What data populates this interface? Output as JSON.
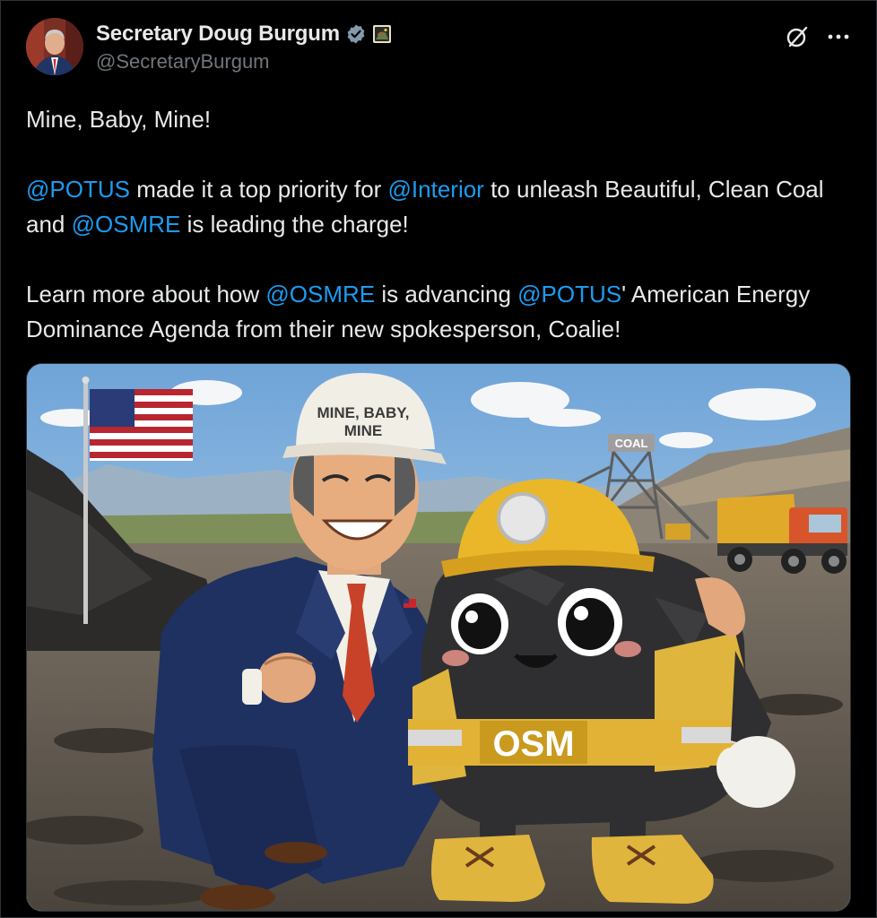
{
  "author": {
    "display_name": "Secretary Doug Burgum",
    "handle": "@SecretaryBurgum",
    "verified_icon": "verified-badge-icon",
    "affiliation_icon": "doi-seal-icon"
  },
  "actions": {
    "grok_icon": "grok-icon",
    "more_icon": "more-horizontal-icon"
  },
  "tweet": {
    "p1": "Mine, Baby, Mine!",
    "p2": {
      "m1": "@POTUS",
      "t1": " made it a top priority for ",
      "m2": "@Interior",
      "t2": " to unleash Beautiful, Clean Coal and ",
      "m3": "@OSMRE",
      "t3": " is leading the charge!"
    },
    "p3": {
      "t1": "Learn more about how ",
      "m1": "@OSMRE",
      "t2": " is advancing ",
      "m2": "@POTUS",
      "t3": "' American Energy Dominance Agenda from their new spokesperson, Coalie!"
    }
  },
  "image": {
    "hat_text_line1": "MINE, BABY,",
    "hat_text_line2": "MINE",
    "tower_sign": "COAL",
    "vest_text": "OSM"
  },
  "colors": {
    "background": "#000000",
    "text": "#e7e9ea",
    "secondary": "#71767b",
    "link": "#1d9bf0"
  }
}
